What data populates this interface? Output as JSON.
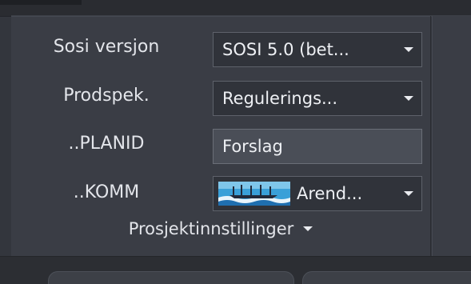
{
  "panel": {
    "rows": [
      {
        "label": "Sosi versjon",
        "value": "SOSI 5.0 (bet...",
        "type": "dropdown"
      },
      {
        "label": "Prodspek.",
        "value": "Regulerings...",
        "type": "dropdown"
      },
      {
        "label": "..PLANID",
        "value": "Forslag",
        "type": "input"
      },
      {
        "label": "..KOMM",
        "value": "Arend...",
        "type": "dropdown",
        "icon": "municipality-coat-of-arms-icon"
      }
    ],
    "footer_label": "Prosjektinnstillinger"
  },
  "colors": {
    "panel_bg": "#3a3d45",
    "field_bg": "#30333a",
    "input_bg": "#4a4e57",
    "text": "#e3e5ea"
  }
}
